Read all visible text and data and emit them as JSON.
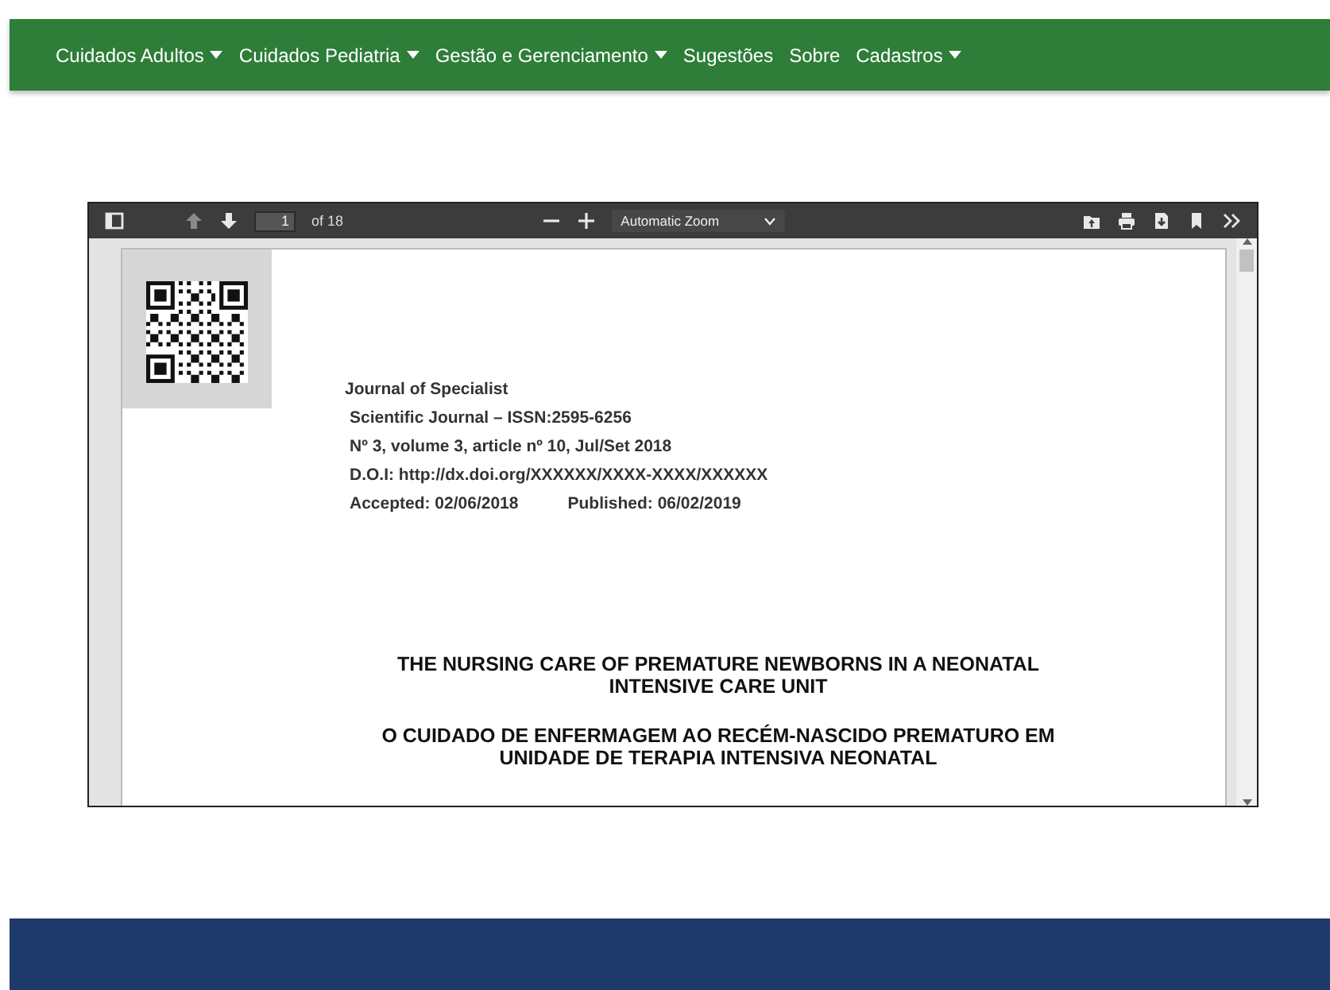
{
  "navbar": {
    "items": [
      {
        "label": "Cuidados Adultos",
        "dropdown": true
      },
      {
        "label": "Cuidados Pediatria",
        "dropdown": true
      },
      {
        "label": "Gestão e Gerenciamento",
        "dropdown": true
      },
      {
        "label": "Sugestões",
        "dropdown": false
      },
      {
        "label": "Sobre",
        "dropdown": false
      },
      {
        "label": "Cadastros",
        "dropdown": true
      }
    ]
  },
  "pdf_viewer": {
    "toolbar": {
      "page_number": "1",
      "page_count": "of 18",
      "zoom": "Automatic Zoom"
    },
    "document": {
      "header_lines": [
        "Journal of Specialist",
        "Scientific Journal – ISSN:2595-6256",
        "Nº 3, volume 3, article nº 10, Jul/Set 2018",
        "D.O.I: http://dx.doi.org/XXXXXX/XXXX-XXXX/XXXXXX"
      ],
      "accepted": "Accepted: 02/06/2018",
      "published": "Published: 06/02/2019",
      "titles": [
        "THE NURSING CARE OF PREMATURE NEWBORNS IN A NEONATAL INTENSIVE CARE UNIT",
        "O CUIDADO DE ENFERMAGEM AO RECÉM-NASCIDO PREMATURO EM UNIDADE DE TERAPIA INTENSIVA NEONATAL"
      ]
    }
  }
}
